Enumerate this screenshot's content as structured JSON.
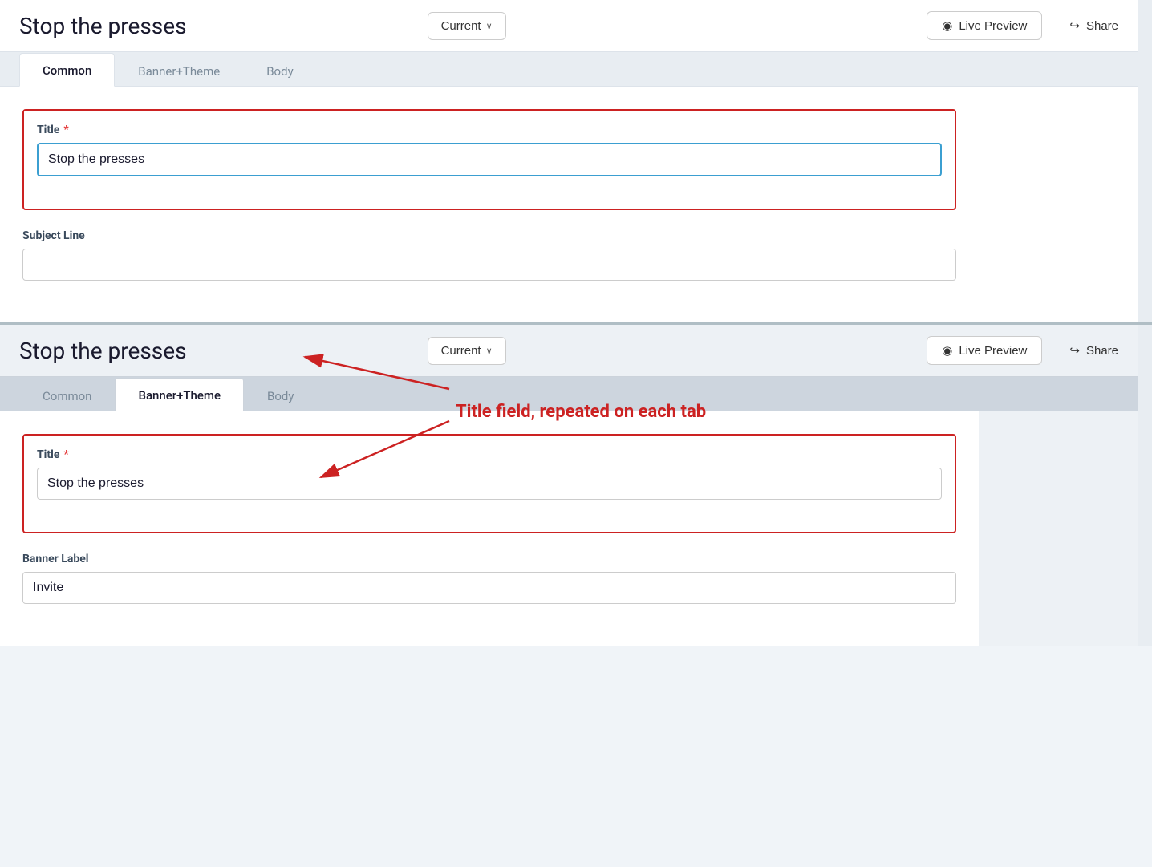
{
  "topPanel": {
    "header": {
      "title": "Stop the presses",
      "versionLabel": "Current",
      "versionChevron": "∨",
      "livePreviewLabel": "Live Preview",
      "shareLabel": "Share"
    },
    "tabs": [
      {
        "id": "common",
        "label": "Common",
        "active": true
      },
      {
        "id": "banner-theme",
        "label": "Banner+Theme",
        "active": false
      },
      {
        "id": "body",
        "label": "Body",
        "active": false
      }
    ],
    "form": {
      "titleLabel": "Title",
      "titleRequired": "*",
      "titleValue": "Stop the presses",
      "titlePlaceholder": "",
      "subjectLineLabel": "Subject Line",
      "subjectLineValue": "",
      "subjectLinePlaceholder": ""
    }
  },
  "annotation": {
    "text": "Title field, repeated on each tab"
  },
  "bottomPanel": {
    "header": {
      "title": "Stop the presses",
      "versionLabel": "Current",
      "versionChevron": "∨",
      "livePreviewLabel": "Live Preview",
      "shareLabel": "Share"
    },
    "tabs": [
      {
        "id": "common",
        "label": "Common",
        "active": false
      },
      {
        "id": "banner-theme",
        "label": "Banner+Theme",
        "active": true
      },
      {
        "id": "body",
        "label": "Body",
        "active": false
      }
    ],
    "form": {
      "titleLabel": "Title",
      "titleRequired": "*",
      "titleValue": "Stop the presses",
      "titlePlaceholder": "",
      "bannerLabelLabel": "Banner Label",
      "bannerLabelValue": "Invite",
      "bannerLabelPlaceholder": ""
    }
  },
  "icons": {
    "eye": "◉",
    "share": "↪"
  }
}
